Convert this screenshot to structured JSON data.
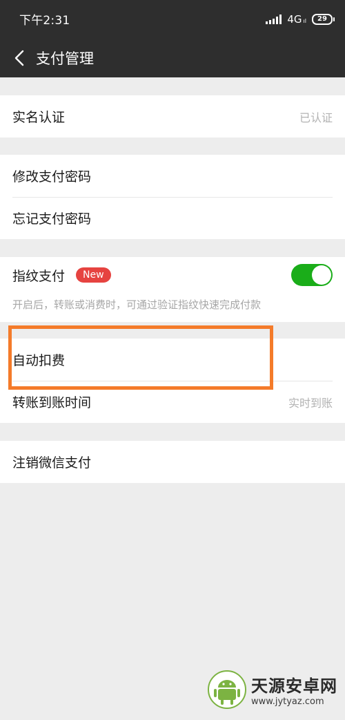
{
  "status_bar": {
    "time": "下午2:31",
    "network": "4G",
    "network_sub": "ıl",
    "battery": "29"
  },
  "header": {
    "back_icon": "chevron-left-icon",
    "title": "支付管理"
  },
  "groups": {
    "identity": {
      "label": "实名认证",
      "value": "已认证"
    },
    "password": {
      "modify_label": "修改支付密码",
      "forgot_label": "忘记支付密码"
    },
    "fingerprint": {
      "label": "指纹支付",
      "badge": "New",
      "enabled": true,
      "description": "开启后，转账或消费时，可通过验证指纹快速完成付款"
    },
    "payment": {
      "auto_deduct_label": "自动扣费",
      "transfer_time_label": "转账到账时间",
      "transfer_time_value": "实时到账"
    },
    "cancel": {
      "label": "注销微信支付"
    }
  },
  "watermark": {
    "name": "天源安卓网",
    "url": "www.jytyaz.com"
  },
  "colors": {
    "header_bg": "#2e2e2e",
    "toggle_on": "#1aad19",
    "badge_red": "#e64340",
    "highlight_orange": "#f47b2a",
    "page_bg": "#ededed"
  }
}
